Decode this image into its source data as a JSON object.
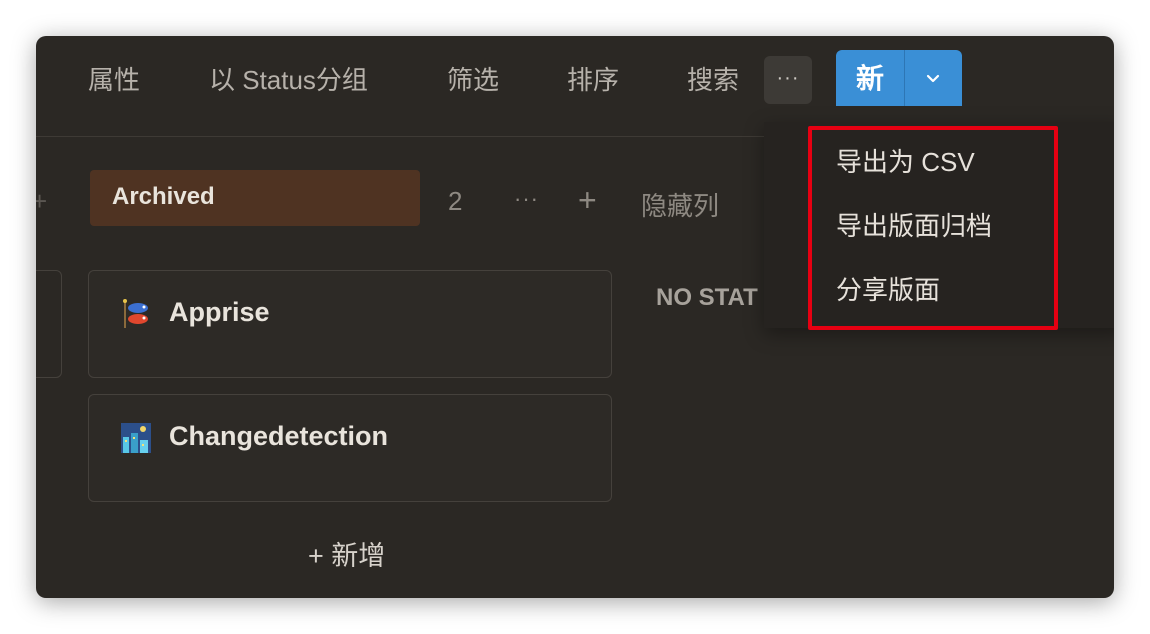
{
  "toolbar": {
    "properties": "属性",
    "group_by": "以 Status分组",
    "filter": "筛选",
    "sort": "排序",
    "search": "搜索",
    "more": "···",
    "new_label": "新"
  },
  "menu": {
    "items": [
      "导出为 CSV",
      "导出版面归档",
      "分享版面"
    ],
    "highlight_color": "#e60012"
  },
  "group": {
    "name": "Archived",
    "count": "2",
    "more": "···",
    "add": "+",
    "hide": "隐藏列",
    "tag_color": "#4f3322"
  },
  "cards": [
    {
      "title": "Apprise",
      "icon": "carp-streamer-icon"
    },
    {
      "title": "Changedetection",
      "icon": "night-city-icon"
    }
  ],
  "add_new": "+ 新增",
  "next_group": "NO STAT",
  "colors": {
    "background": "#2b2824",
    "accent": "#3a8fd6"
  }
}
